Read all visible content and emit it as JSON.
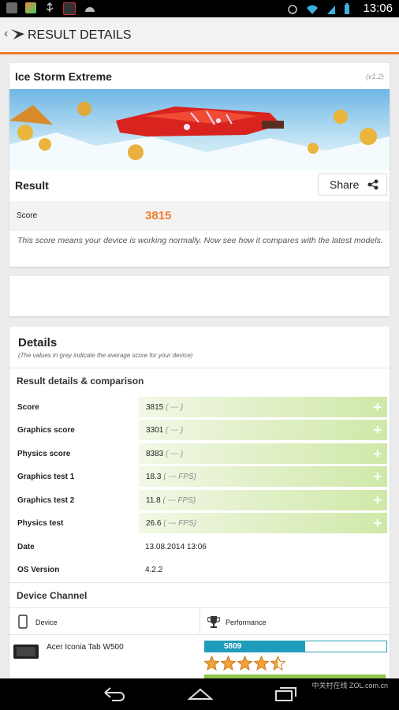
{
  "status_bar": {
    "time": "13:06"
  },
  "app_bar": {
    "title": "RESULT DETAILS"
  },
  "test": {
    "name": "Ice Storm Extreme",
    "version": "(v1.2)"
  },
  "result": {
    "label": "Result",
    "share_label": "Share",
    "score_label": "Score",
    "score_value": "3815",
    "note": "This score means your device is working normally. Now see how it compares with the latest models."
  },
  "details": {
    "title": "Details",
    "subtitle": "(The values in grey indicate the average score for your device)",
    "section_title": "Result details & comparison",
    "rows": [
      {
        "label": "Score",
        "value": "3815",
        "avg": "( --- )"
      },
      {
        "label": "Graphics score",
        "value": "3301",
        "avg": "( --- )"
      },
      {
        "label": "Physics score",
        "value": "8383",
        "avg": "( --- )"
      },
      {
        "label": "Graphics test 1",
        "value": "18.3",
        "avg": "( --- FPS)"
      },
      {
        "label": "Graphics test 2",
        "value": "11.8",
        "avg": "( --- FPS)"
      },
      {
        "label": "Physics test",
        "value": "26.6",
        "avg": "( --- FPS)"
      }
    ],
    "date_label": "Date",
    "date_value": "13.08.2014 13:06",
    "os_label": "OS Version",
    "os_value": "4.2.2"
  },
  "device_channel": {
    "title": "Device Channel",
    "col_device": "Device",
    "col_performance": "Performance",
    "device_name": "Acer Iconia Tab W500",
    "performance_value": "5809",
    "performance_fraction": 0.55,
    "rating_stars": 4.5
  },
  "watermark": "中关村在线 ZOL.com.cn",
  "colors": {
    "accent": "#f07b2a",
    "bar": "#1f9bbb",
    "green": "#cfe8a8"
  }
}
